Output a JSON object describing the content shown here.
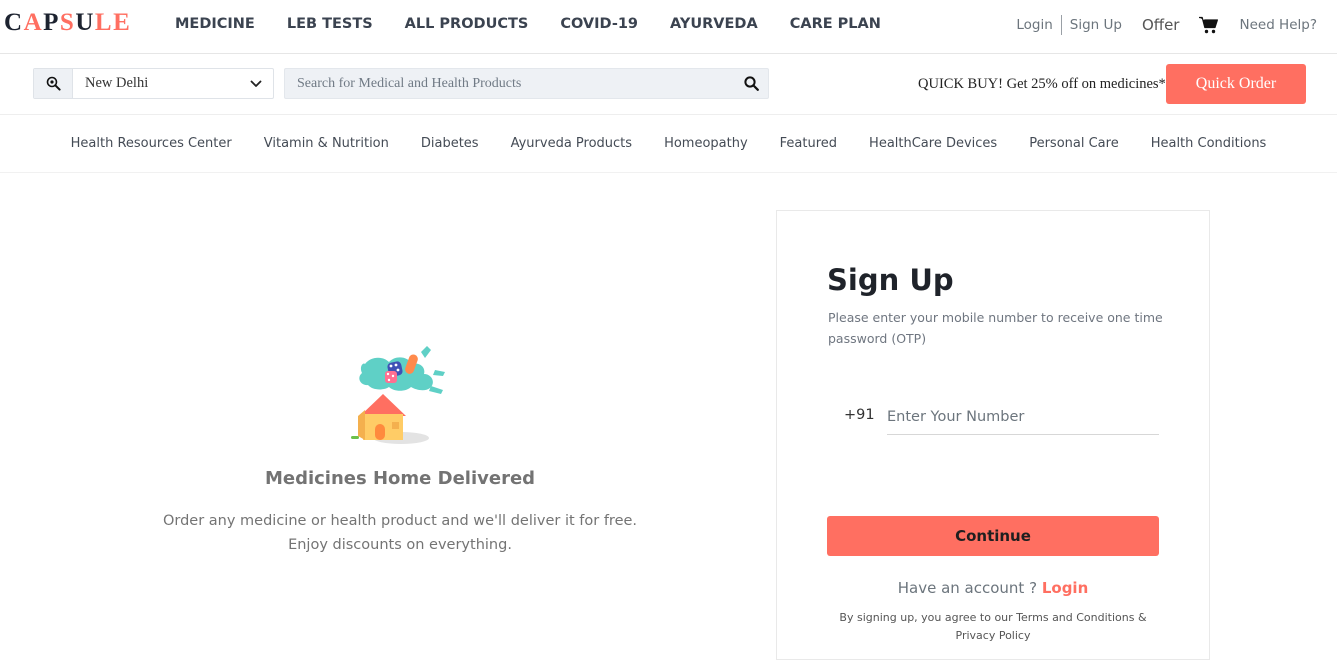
{
  "brand": {
    "letters": [
      {
        "ch": "C",
        "color": "#1d2330"
      },
      {
        "ch": "A",
        "color": "#ff6f61"
      },
      {
        "ch": "P",
        "color": "#1d2330"
      },
      {
        "ch": "S",
        "color": "#ff6f61"
      },
      {
        "ch": "U",
        "color": "#1d2330"
      },
      {
        "ch": "L",
        "color": "#ff6f61"
      },
      {
        "ch": "E",
        "color": "#ff6f61"
      }
    ]
  },
  "nav": {
    "items": [
      {
        "label": "MEDICINE"
      },
      {
        "label": "LEB TESTS"
      },
      {
        "label": "ALL PRODUCTS"
      },
      {
        "label": "COVID-19"
      },
      {
        "label": "AYURVEDA"
      },
      {
        "label": "CARE PLAN"
      }
    ]
  },
  "top_right": {
    "login": "Login",
    "signup": "Sign Up",
    "offer": "Offer",
    "cart_icon": "shopping-cart-icon",
    "help": "Need Help?"
  },
  "location": {
    "icon": "location-search-icon",
    "city": "New Delhi",
    "dropdown_icon": "chevron-down-icon"
  },
  "search": {
    "placeholder": "Search for Medical and Health Products",
    "value": "",
    "icon": "search-icon"
  },
  "promo": {
    "text": "QUICK BUY! Get 25% off on medicines*",
    "button": "Quick Order"
  },
  "categories": [
    {
      "label": "Health Resources Center"
    },
    {
      "label": "Vitamin & Nutrition"
    },
    {
      "label": "Diabetes"
    },
    {
      "label": "Ayurveda Products"
    },
    {
      "label": "Homeopathy"
    },
    {
      "label": "Featured"
    },
    {
      "label": "HealthCare Devices"
    },
    {
      "label": "Personal Care"
    },
    {
      "label": "Health Conditions"
    }
  ],
  "hero": {
    "title": "Medicines Home Delivered",
    "line1": "Order any medicine or health product and we'll deliver it for free.",
    "line2": "Enjoy discounts on everything."
  },
  "signup_form": {
    "title": "Sign Up",
    "description": "Please enter your mobile number to receive one time password (OTP)",
    "country_code": "+91",
    "phone_placeholder": "Enter Your Number",
    "phone_value": "",
    "continue_label": "Continue",
    "have_account": "Have an account ?",
    "login_link": "Login",
    "terms": "By signing up, you agree to our Terms and Conditions & Privacy Policy"
  },
  "colors": {
    "accent": "#ff6f61",
    "nav_text": "#3b4350",
    "input_bg": "#eef1f5"
  }
}
